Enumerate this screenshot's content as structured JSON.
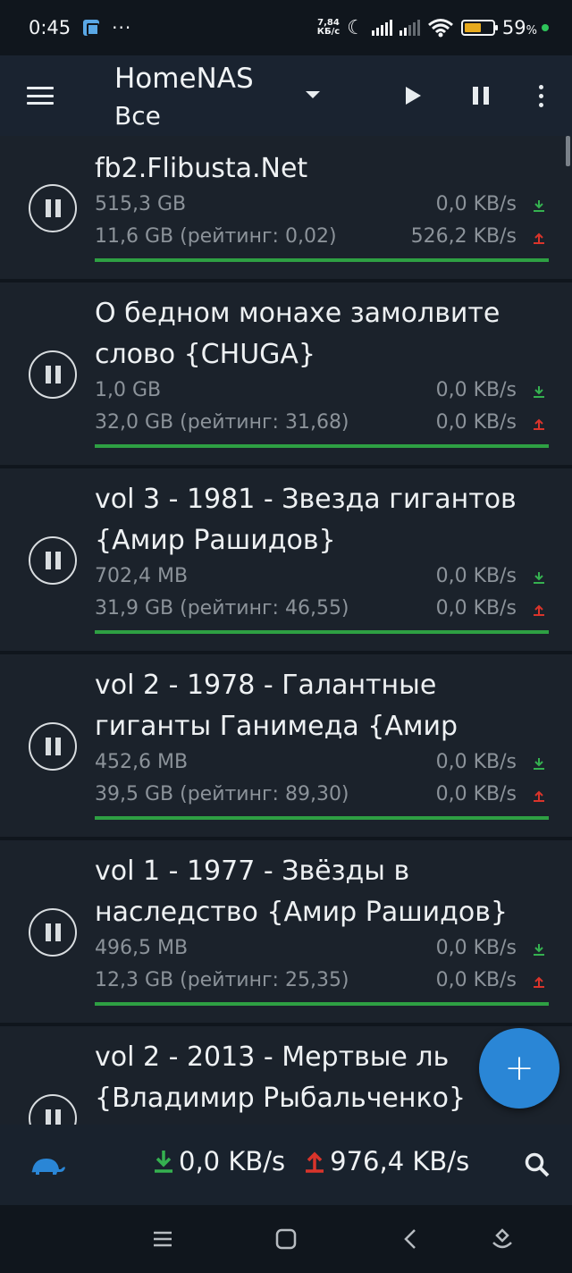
{
  "status_bar": {
    "time": "0:45",
    "dots": "···",
    "speed_value": "7,84",
    "speed_unit": "КБ/с",
    "battery": "59",
    "battery_unit": "%"
  },
  "toolbar": {
    "title": "HomeNAS",
    "subtitle": "Все",
    "icons": [
      "menu-icon",
      "dropdown-icon",
      "play-icon",
      "pause-icon",
      "more-icon"
    ]
  },
  "torrents": [
    {
      "name": "fb2.Flibusta.Net",
      "size": "515,3 GB",
      "uploaded": "11,6 GB (рейтинг: 0,02)",
      "down_speed": "0,0 KB/s",
      "up_speed": "526,2 KB/s"
    },
    {
      "name": "О бедном монахе замолвите слово {CHUGA}",
      "size": "1,0 GB",
      "uploaded": "32,0 GB (рейтинг: 31,68)",
      "down_speed": "0,0 KB/s",
      "up_speed": "0,0 KB/s"
    },
    {
      "name": "vol 3 - 1981 - Звезда гигантов {Амир Рашидов}",
      "size": "702,4 MB",
      "uploaded": "31,9 GB (рейтинг: 46,55)",
      "down_speed": "0,0 KB/s",
      "up_speed": "0,0 KB/s"
    },
    {
      "name": "vol 2 - 1978 - Галантные гиганты Ганимеда {Амир",
      "size": "452,6 MB",
      "uploaded": "39,5 GB (рейтинг: 89,30)",
      "down_speed": "0,0 KB/s",
      "up_speed": "0,0 KB/s"
    },
    {
      "name": "vol 1 - 1977 - Звёзды в наследство {Амир Рашидов}",
      "size": "496,5 MB",
      "uploaded": "12,3 GB (рейтинг: 25,35)",
      "down_speed": "0,0 KB/s",
      "up_speed": "0,0 KB/s"
    },
    {
      "name_line1": "vol 2 - 2013 -  Мертвые ль",
      "name_line2": "{Владимир Рыбальченко}"
    }
  ],
  "bottom_bar": {
    "download_speed": "0,0 KB/s",
    "upload_speed": "976,4 KB/s"
  },
  "fab": {
    "label": "+"
  },
  "colors": {
    "background": "#10161d",
    "toolbar": "#1a2330",
    "card": "#1b222b",
    "progress": "#2ea043",
    "download_arrow": "#35b150",
    "upload_arrow": "#d9342b",
    "fab": "#2a86d6",
    "turtle": "#2a86d6"
  }
}
